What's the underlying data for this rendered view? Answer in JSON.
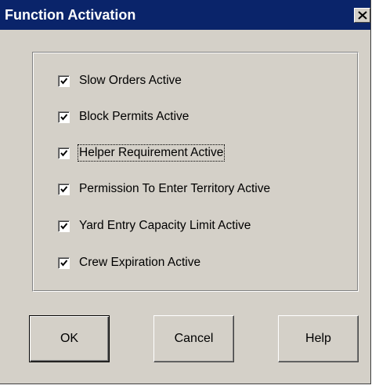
{
  "window": {
    "title": "Function Activation",
    "close_icon": "close-icon"
  },
  "options": [
    {
      "label": "Slow Orders Active",
      "checked": true
    },
    {
      "label": "Block Permits Active",
      "checked": true
    },
    {
      "label": "Helper Requirement Active",
      "checked": true,
      "focused": true
    },
    {
      "label": "Permission To Enter Territory Active",
      "checked": true
    },
    {
      "label": "Yard Entry Capacity Limit Active",
      "checked": true
    },
    {
      "label": "Crew Expiration Active",
      "checked": true
    }
  ],
  "buttons": {
    "ok_label": "OK",
    "cancel_label": "Cancel",
    "help_label": "Help"
  },
  "colors": {
    "titlebar": "#0a246a",
    "face": "#d4d0c8"
  }
}
